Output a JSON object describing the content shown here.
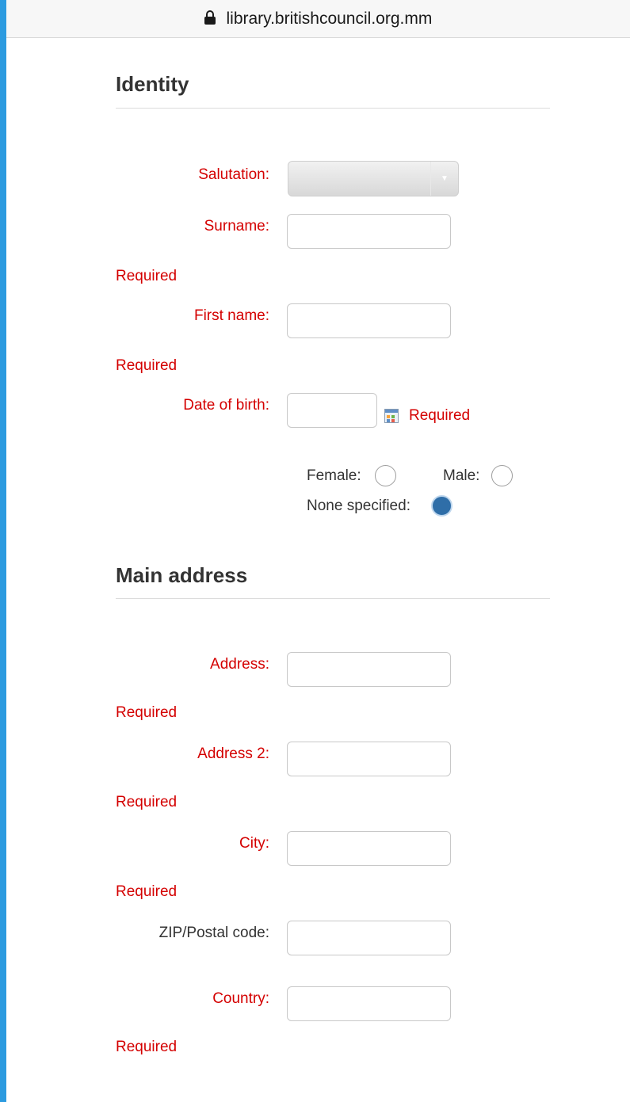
{
  "browser": {
    "url": "library.britishcouncil.org.mm"
  },
  "identity": {
    "title": "Identity",
    "salutation_label": "Salutation:",
    "salutation_value": "",
    "surname_label": "Surname:",
    "surname_value": "",
    "surname_error": "Required",
    "first_name_label": "First name:",
    "first_name_value": "",
    "first_name_error": "Required",
    "dob_label": "Date of birth:",
    "dob_value": "",
    "dob_error": "Required",
    "gender": {
      "female_label": "Female:",
      "male_label": "Male:",
      "none_label": "None specified:",
      "selected": "none"
    }
  },
  "address": {
    "title": "Main address",
    "address_label": "Address:",
    "address_error": "Required",
    "address2_label": "Address 2:",
    "address2_error": "Required",
    "city_label": "City:",
    "city_error": "Required",
    "zip_label": "ZIP/Postal code:",
    "country_label": "Country:",
    "country_error": "Required"
  },
  "colors": {
    "required_red": "#d40000",
    "selected_radio": "#2f6ea8",
    "outer_background": "#2c9be0"
  },
  "icons": {
    "lock": "lock-icon",
    "calendar": "calendar-icon",
    "dropdown": "chevron-down-icon"
  }
}
